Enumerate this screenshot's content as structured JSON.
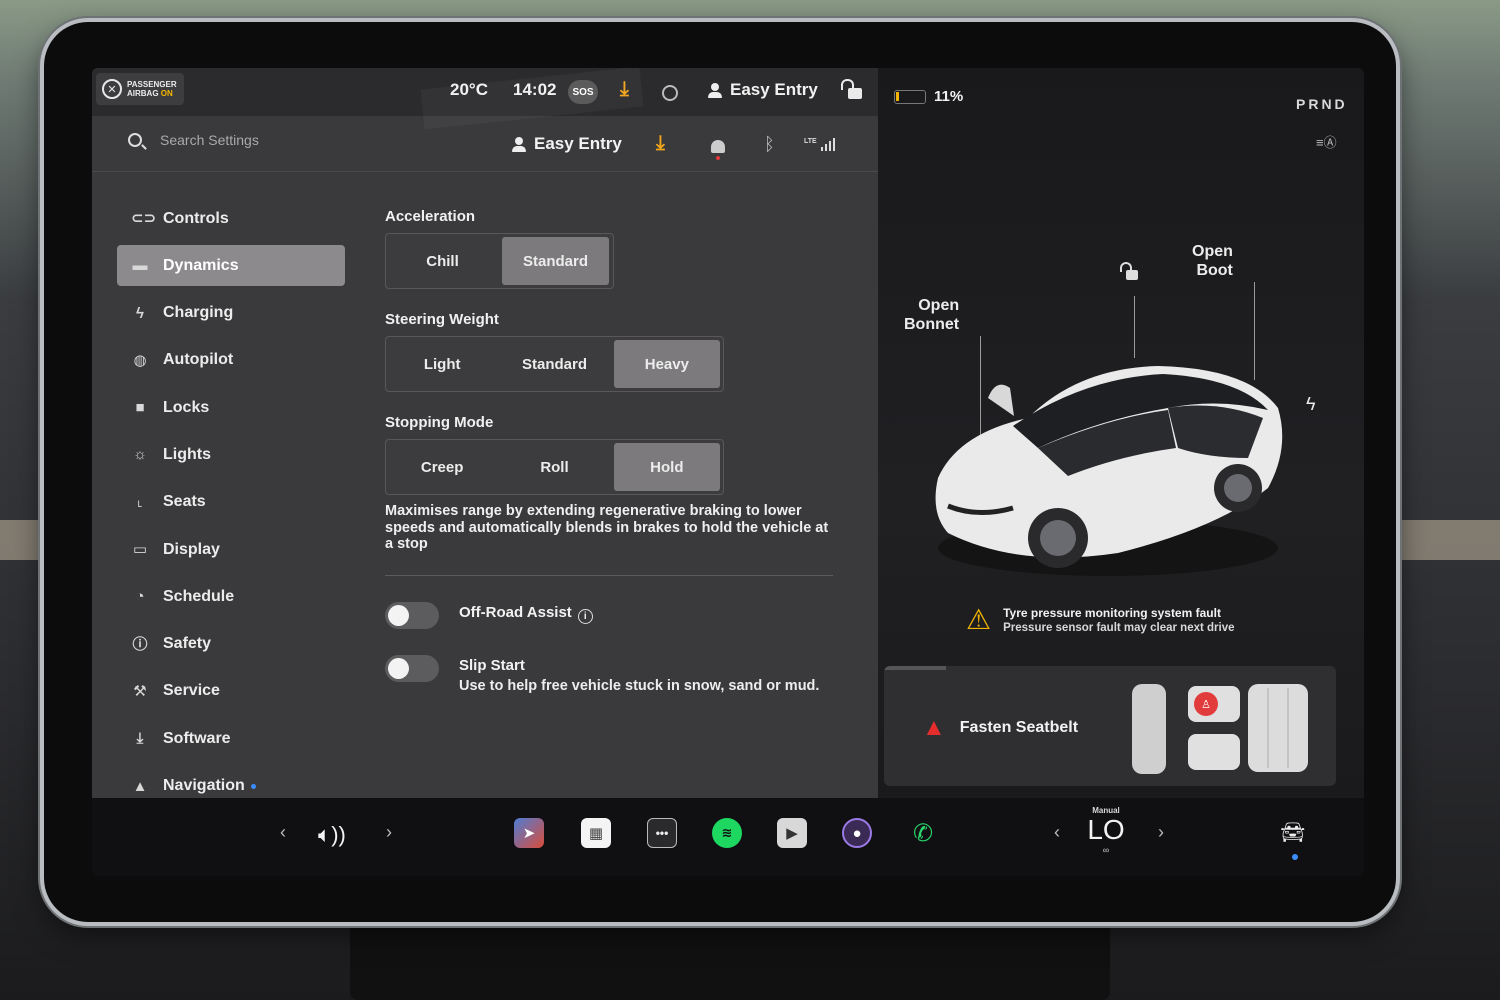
{
  "status_bar": {
    "airbag_line1": "PASSENGER",
    "airbag_line2": "AIRBAG",
    "airbag_line3": "ON",
    "temperature": "20°C",
    "time": "14:02",
    "sos": "SOS",
    "profile": "Easy Entry",
    "battery": "11%",
    "gear": "PRND"
  },
  "header": {
    "search_placeholder": "Search Settings",
    "profile": "Easy Entry",
    "lte": "LTE"
  },
  "menu": {
    "items": [
      {
        "label": "Controls",
        "icon": "toggle-icon"
      },
      {
        "label": "Dynamics",
        "icon": "car-icon",
        "active": true
      },
      {
        "label": "Charging",
        "icon": "bolt-icon"
      },
      {
        "label": "Autopilot",
        "icon": "steering-wheel-icon"
      },
      {
        "label": "Locks",
        "icon": "lock-icon"
      },
      {
        "label": "Lights",
        "icon": "sun-icon"
      },
      {
        "label": "Seats",
        "icon": "seat-icon"
      },
      {
        "label": "Display",
        "icon": "display-icon"
      },
      {
        "label": "Schedule",
        "icon": "alarm-clock-icon"
      },
      {
        "label": "Safety",
        "icon": "alert-circle-icon"
      },
      {
        "label": "Service",
        "icon": "wrench-icon"
      },
      {
        "label": "Software",
        "icon": "download-icon"
      },
      {
        "label": "Navigation",
        "icon": "navigation-icon"
      }
    ]
  },
  "dynamics": {
    "acceleration": {
      "title": "Acceleration",
      "options": [
        "Chill",
        "Standard"
      ],
      "selected": "Standard"
    },
    "steering": {
      "title": "Steering Weight",
      "options": [
        "Light",
        "Standard",
        "Heavy"
      ],
      "selected": "Heavy"
    },
    "stopping": {
      "title": "Stopping Mode",
      "options": [
        "Creep",
        "Roll",
        "Hold"
      ],
      "selected": "Hold",
      "description": "Maximises range by extending regenerative braking to lower speeds and automatically blends in brakes to hold the vehicle at a stop"
    },
    "offroad": {
      "label": "Off-Road Assist",
      "enabled": false
    },
    "slipstart": {
      "label": "Slip Start",
      "description": "Use to help free vehicle stuck in snow, sand or mud.",
      "enabled": false
    }
  },
  "car_view": {
    "bonnet_line1": "Open",
    "bonnet_line2": "Bonnet",
    "boot_line1": "Open",
    "boot_line2": "Boot",
    "alert_title": "Tyre pressure monitoring system fault",
    "alert_sub": "Pressure sensor fault may clear next drive",
    "seatbelt": "Fasten Seatbelt"
  },
  "dock": {
    "climate_mode": "Manual",
    "climate_temp": "LO",
    "apps": [
      "navigation-app-icon",
      "calendar-app-icon",
      "more-apps-icon",
      "spotify-app-icon",
      "media-player-icon",
      "camera-app-icon",
      "phone-app-icon"
    ]
  },
  "colors": {
    "accent_orange": "#f2a51a",
    "warning_yellow": "#f2b400",
    "alert_red": "#e52d2d",
    "active_segment": "#7c7a7c",
    "active_menu": "#8c8a8c"
  }
}
